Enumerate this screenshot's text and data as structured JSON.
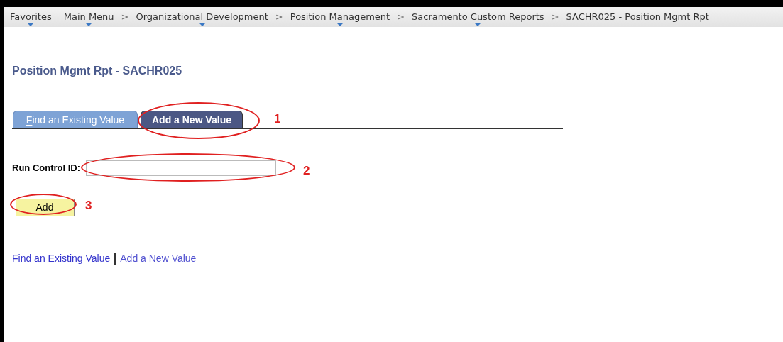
{
  "breadcrumb": [
    {
      "label": "Favorites",
      "menu": true
    },
    {
      "label": "Main Menu",
      "menu": true
    },
    {
      "label": "Organizational Development",
      "menu": true
    },
    {
      "label": "Position Management",
      "menu": true
    },
    {
      "label": "Sacramento Custom Reports",
      "menu": true
    },
    {
      "label": "SACHR025 - Position Mgmt Rpt",
      "menu": false
    }
  ],
  "separator": ">",
  "page_title": "Position Mgmt Rpt - SACHR025",
  "tabs": [
    {
      "label": "Find an Existing Value",
      "selected": false
    },
    {
      "label": "Add a New Value",
      "selected": true
    }
  ],
  "run_control": {
    "label": "Run Control ID:"
  },
  "add_button": "Add",
  "links": [
    {
      "label": "Find an Existing Value",
      "selected": false
    },
    {
      "label": "Add a New Value",
      "selected": true
    }
  ],
  "annotations": [
    {
      "number": "1"
    },
    {
      "number": "2"
    },
    {
      "number": "3"
    }
  ]
}
